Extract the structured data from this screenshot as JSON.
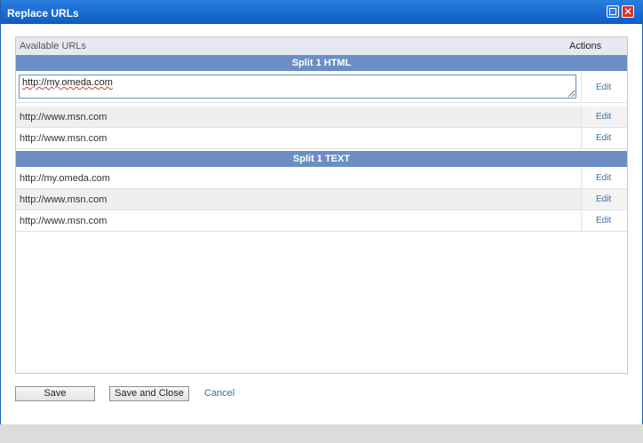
{
  "window": {
    "title": "Replace URLs"
  },
  "panel": {
    "available_label": "Available URLs",
    "actions_label": "Actions"
  },
  "groups": [
    {
      "title": "Split 1 HTML",
      "rows": [
        {
          "url": "http://my.omeda.com",
          "action": "Edit",
          "editing": true
        },
        {
          "url": "http://www.msn.com",
          "action": "Edit"
        },
        {
          "url": "http://www.msn.com",
          "action": "Edit"
        }
      ]
    },
    {
      "title": "Split 1 TEXT",
      "rows": [
        {
          "url": "http://my.omeda.com",
          "action": "Edit"
        },
        {
          "url": "http://www.msn.com",
          "action": "Edit"
        },
        {
          "url": "http://www.msn.com",
          "action": "Edit"
        }
      ]
    }
  ],
  "buttons": {
    "save": "Save",
    "save_and_close": "Save and Close",
    "cancel": "Cancel"
  },
  "colors": {
    "titlebar": "#0f5cc4",
    "group_header": "#6b8fc4",
    "link": "#3a6ea5",
    "close": "#d7362b"
  },
  "icons": {
    "maximize": "maximize-icon",
    "close": "close-icon"
  }
}
